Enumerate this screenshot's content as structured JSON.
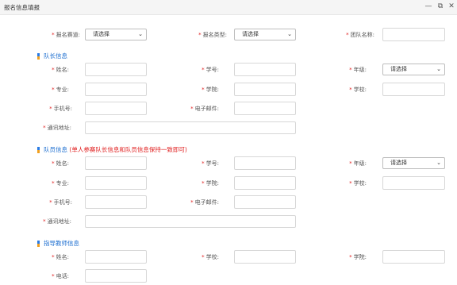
{
  "window": {
    "title": "报名信息填报",
    "minimize": "—",
    "maximize": "⧉",
    "close": "✕"
  },
  "top": {
    "competition_label": "报名赛道:",
    "competition_value": "请选择",
    "type_label": "报名类型:",
    "type_value": "请选择",
    "team_label": "团队名称:"
  },
  "leader": {
    "section_title": "队长信息",
    "name_label": "姓名:",
    "student_id_label": "学号:",
    "grade_label": "年级:",
    "grade_value": "请选择",
    "major_label": "专业:",
    "college_label": "学院:",
    "school_label": "学校:",
    "phone_label": "手机号:",
    "email_label": "电子邮件:",
    "address_label": "通讯地址:"
  },
  "member": {
    "section_title": "队员信息",
    "section_note": "(单人参赛队长信息和队员信息保持一致即可)",
    "name_label": "姓名:",
    "student_id_label": "学号:",
    "grade_label": "年级:",
    "grade_value": "请选择",
    "major_label": "专业:",
    "college_label": "学院:",
    "school_label": "学校:",
    "phone_label": "手机号:",
    "email_label": "电子邮件:",
    "address_label": "通讯地址:"
  },
  "teacher": {
    "section_title": "指导教师信息",
    "name_label": "姓名:",
    "school_label": "学校:",
    "college_label": "学院:",
    "phone_label": "电话:"
  },
  "required_mark": "*",
  "colors": {
    "section": "#1e6fd0",
    "required": "#e02020"
  }
}
